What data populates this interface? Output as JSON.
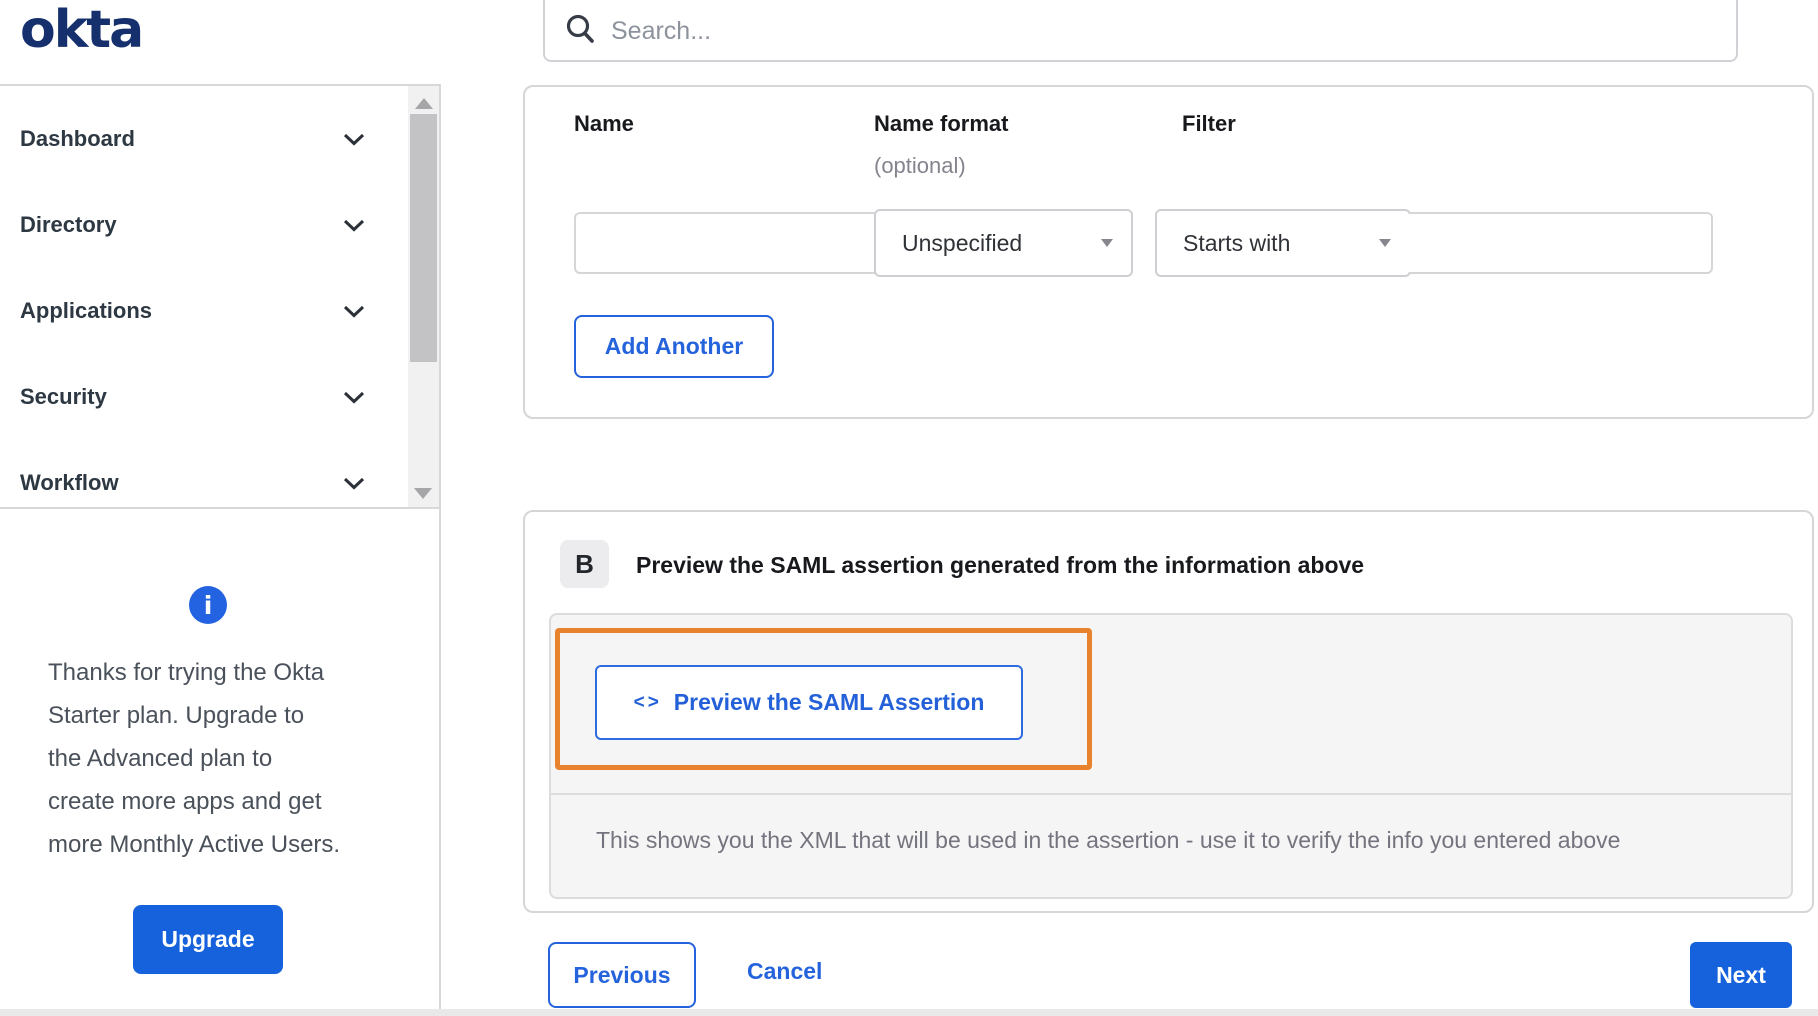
{
  "brand": {
    "logo_text": "okta"
  },
  "header": {
    "search_placeholder": "Search..."
  },
  "sidebar": {
    "items": [
      {
        "label": "Dashboard"
      },
      {
        "label": "Directory"
      },
      {
        "label": "Applications"
      },
      {
        "label": "Security"
      },
      {
        "label": "Workflow"
      }
    ],
    "upsell": {
      "lines": [
        "Thanks for trying the Okta",
        "Starter plan. Upgrade to",
        "the Advanced plan to",
        "create more apps and get",
        "more Monthly Active Users."
      ],
      "button_label": "Upgrade"
    }
  },
  "attribute_form": {
    "columns": [
      {
        "label": "Name",
        "sublabel": ""
      },
      {
        "label": "Name format",
        "sublabel": "(optional)"
      },
      {
        "label": "Filter",
        "sublabel": ""
      }
    ],
    "name_value": "",
    "name_format_selected": "Unspecified",
    "filter_type_selected": "Starts with",
    "filter_value": "",
    "add_another_label": "Add Another"
  },
  "preview_section": {
    "badge": "B",
    "title": "Preview the SAML assertion generated from the information above",
    "preview_button": {
      "icon_glyph": "<>",
      "label": "Preview the SAML Assertion"
    },
    "help_text": "This shows you the XML that will be used in the assertion - use it to verify the info you entered above"
  },
  "footer": {
    "previous_label": "Previous",
    "cancel_label": "Cancel",
    "next_label": "Next"
  },
  "icons": {
    "info_glyph": "i"
  },
  "colors": {
    "primary_blue": "#1662dd",
    "link_blue": "#2563dc",
    "logo_navy": "#16306e",
    "highlight_orange": "#e8822d"
  }
}
